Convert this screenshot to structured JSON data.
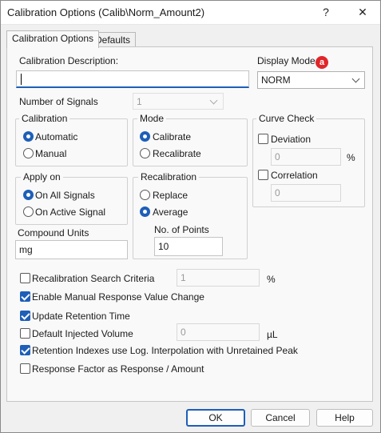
{
  "window": {
    "title": "Calibration Options (Calib\\Norm_Amount2)",
    "help_glyph": "?",
    "close_glyph": "✕"
  },
  "tabs": [
    {
      "label": "Calibration Options",
      "active": true
    },
    {
      "label": "Defaults",
      "active": false
    }
  ],
  "description": {
    "label": "Calibration Description:",
    "value": ""
  },
  "display_mode": {
    "label": "Display Mode",
    "value": "NORM",
    "badge": "a",
    "badge_color": "#e0262b"
  },
  "number_of_signals": {
    "label": "Number of Signals",
    "value": "1"
  },
  "calibration": {
    "title": "Calibration",
    "options": [
      {
        "label": "Automatic",
        "selected": true
      },
      {
        "label": "Manual",
        "selected": false
      }
    ]
  },
  "mode": {
    "title": "Mode",
    "options": [
      {
        "label": "Calibrate",
        "selected": true
      },
      {
        "label": "Recalibrate",
        "selected": false
      }
    ]
  },
  "curve_check": {
    "title": "Curve Check",
    "deviation": {
      "label": "Deviation",
      "checked": false,
      "value": "0",
      "unit": "%"
    },
    "correlation": {
      "label": "Correlation",
      "checked": false,
      "value": "0"
    }
  },
  "apply_on": {
    "title": "Apply on",
    "options": [
      {
        "label": "On All Signals",
        "selected": true
      },
      {
        "label": "On Active Signal",
        "selected": false
      }
    ]
  },
  "recalibration": {
    "title": "Recalibration",
    "options": [
      {
        "label": "Replace",
        "selected": false
      },
      {
        "label": "Average",
        "selected": true
      }
    ],
    "points_label": "No. of Points",
    "points_value": "10"
  },
  "compound_units": {
    "label": "Compound Units",
    "value": "mg"
  },
  "checkboxes": [
    {
      "label": "Recalibration Search Criteria",
      "checked": false,
      "value": "1",
      "unit": "%"
    },
    {
      "label": "Enable Manual Response Value Change",
      "checked": true
    },
    {
      "label": "Update Retention Time",
      "checked": true
    },
    {
      "label": "Default Injected Volume",
      "checked": false,
      "value": "0",
      "unit": "µL"
    },
    {
      "label": "Retention Indexes use Log. Interpolation with Unretained Peak",
      "checked": true
    },
    {
      "label": "Response Factor as Response / Amount",
      "checked": false
    }
  ],
  "buttons": {
    "ok": "OK",
    "cancel": "Cancel",
    "help": "Help"
  },
  "colors": {
    "accent": "#1e5fb8",
    "underline": "#1e5fb8"
  }
}
